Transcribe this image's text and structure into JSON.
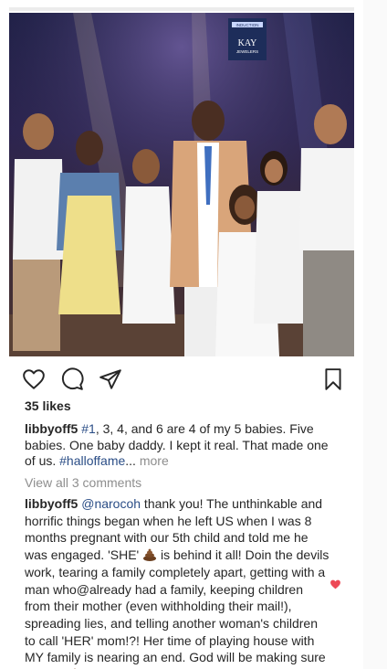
{
  "photo": {
    "banner_line1": "INDUCTION",
    "banner_brand": "KAY",
    "banner_sub": "JEWELERS"
  },
  "actions": {
    "like_icon": "heart-outline-icon",
    "comment_icon": "comment-bubble-icon",
    "share_icon": "paper-plane-icon",
    "save_icon": "bookmark-icon"
  },
  "post": {
    "likes": "35 likes",
    "caption": {
      "username": "libbyoff5",
      "hashtag1": "#1",
      "text1": ", 3, 4, and 6 are 4 of my 5 babies. Five babies. One baby daddy. I kept it real. That made one of us. ",
      "hashtag2": "#halloffame",
      "ellipsis": "...",
      "more": "more"
    },
    "view_all": "View all 3 comments",
    "comment": {
      "username": "libbyoff5",
      "mention": "@narocoh",
      "text1": " thank you! The unthinkable and horrific things began when he left US when I was 8 months pregnant with our 5th child and told me he was engaged. 'SHE'",
      "text2": " is behind it all! Doin the devils work, tearing a family completely apart, getting with a man who@already had a family, keeping children from their mother (even withholding their mail!), spreading lies, and telling another woman's children to call 'HER' mom!?! Her time of playing house with MY family is nearing an end. God will be making sure of that!"
    },
    "colors": {
      "link": "#2a4d86",
      "muted": "#8e8e8e",
      "like_red": "#ed4956"
    }
  }
}
